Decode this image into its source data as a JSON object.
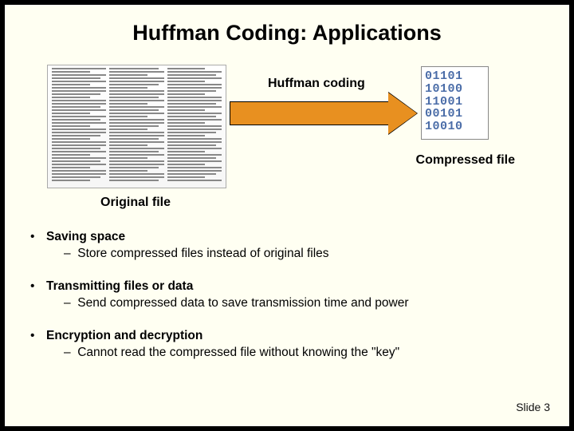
{
  "title": "Huffman Coding: Applications",
  "diagram": {
    "arrow_label": "Huffman coding",
    "original_label": "Original file",
    "compressed_label": "Compressed file",
    "bits": [
      "01101",
      "10100",
      "11001",
      "00101",
      "10010"
    ]
  },
  "bullets": [
    {
      "head": "Saving space",
      "sub": "Store compressed files instead of original files"
    },
    {
      "head": "Transmitting files or data",
      "sub": "Send compressed data to save transmission time and power"
    },
    {
      "head": "Encryption and decryption",
      "sub": "Cannot read the compressed file without knowing the \"key\""
    }
  ],
  "slide_num": "Slide 3"
}
